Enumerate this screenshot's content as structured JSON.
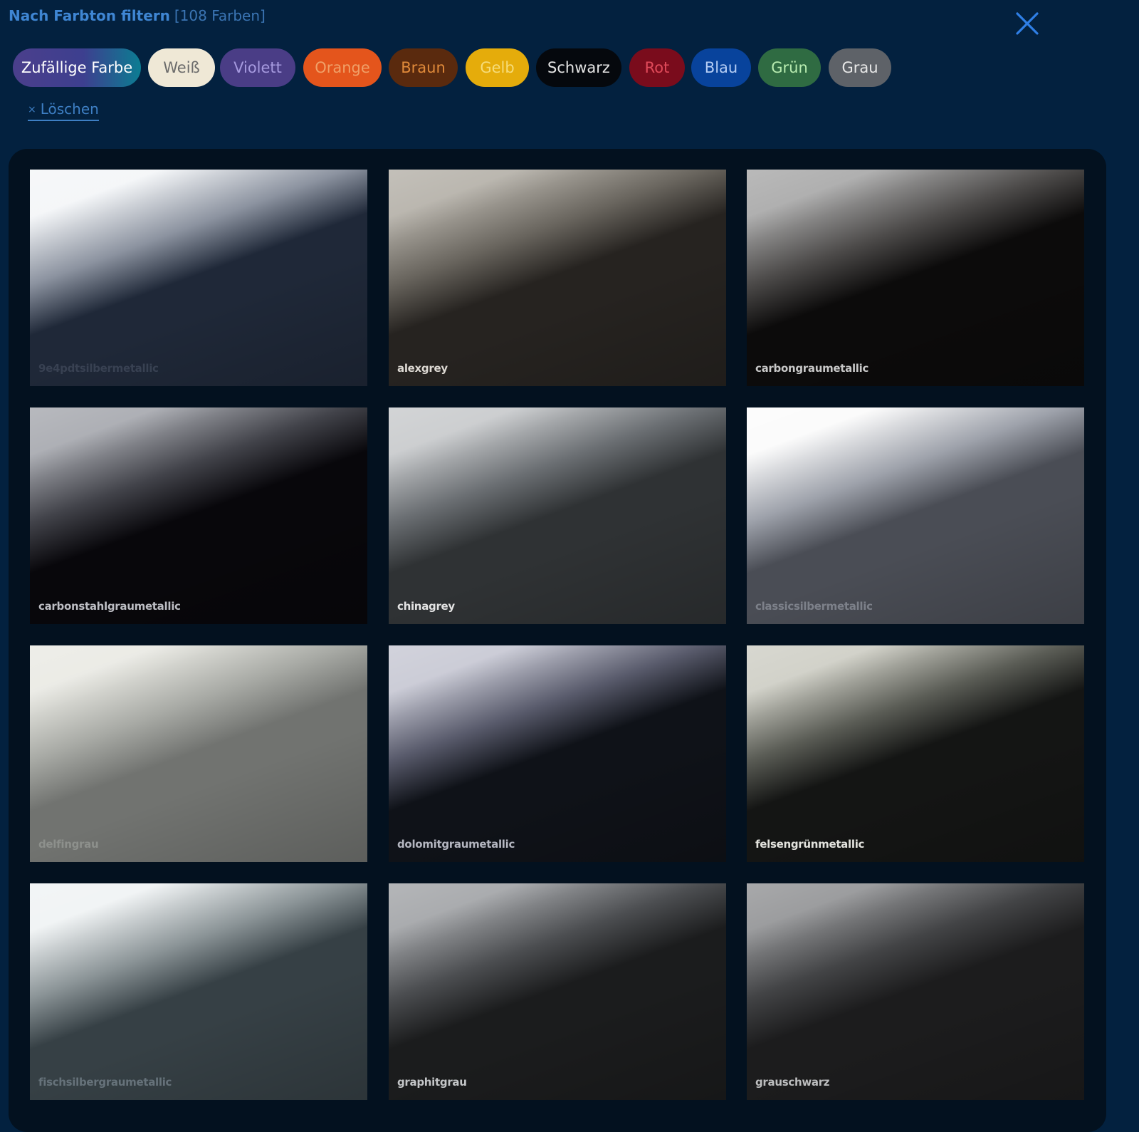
{
  "header": {
    "title": "Nach Farbton filtern",
    "count": "[108 Farben]"
  },
  "close_icon": "close-icon",
  "chips": [
    {
      "label": "Zufällige Farbe",
      "bg": "linear-gradient(90deg,#4b3f8c 0%,#3d3f8f 55%,#0c7d92 100%)",
      "fg": "#ffffff"
    },
    {
      "label": "Weiß",
      "bg": "#efe8d6",
      "fg": "#6b6b6b"
    },
    {
      "label": "Violett",
      "bg": "#4a3d86",
      "fg": "#a69adf"
    },
    {
      "label": "Orange",
      "bg": "#e4551c",
      "fg": "#f0a068"
    },
    {
      "label": "Braun",
      "bg": "#5a2a0e",
      "fg": "#e08a3a"
    },
    {
      "label": "Gelb",
      "bg": "#e5ac0b",
      "fg": "#f6dc7a"
    },
    {
      "label": "Schwarz",
      "bg": "#05080d",
      "fg": "#e6e6e6"
    },
    {
      "label": "Rot",
      "bg": "#7a0c1c",
      "fg": "#e04a5a"
    },
    {
      "label": "Blau",
      "bg": "#08439c",
      "fg": "#b6cef5"
    },
    {
      "label": "Grün",
      "bg": "#2f6b42",
      "fg": "#b8ecb0"
    },
    {
      "label": "Grau",
      "bg": "#5e6268",
      "fg": "#e8e8e8"
    }
  ],
  "clear": {
    "icon": "×",
    "label": "Löschen"
  },
  "swatches": [
    {
      "name": "9e4pdtsilbermetallic",
      "top": "#f4f6f8",
      "mid": "#8c93a0",
      "bottom": "#1f2838",
      "label_color": "#384152"
    },
    {
      "name": "alexgrey",
      "top": "#b6b2aa",
      "mid": "#69655e",
      "bottom": "#262320",
      "label_color": "#dedad4"
    },
    {
      "name": "carbongraumetallic",
      "top": "#aaaaaa",
      "mid": "#4d4b4a",
      "bottom": "#0c0b0b",
      "label_color": "#c8c8c8"
    },
    {
      "name": "carbonstahlgraumetallic",
      "top": "#a8aab0",
      "mid": "#42434a",
      "bottom": "#08070b",
      "label_color": "#bdbec4"
    },
    {
      "name": "chinagrey",
      "top": "#c9cbcd",
      "mid": "#6b6f73",
      "bottom": "#2f3234",
      "label_color": "#e4e4e4"
    },
    {
      "name": "classicsilbermetallic",
      "top": "#fbfbfb",
      "mid": "#9ea2ab",
      "bottom": "#4a4d55",
      "label_color": "#7d818a"
    },
    {
      "name": "delfingrau",
      "top": "#eaeae4",
      "mid": "#a8aaa5",
      "bottom": "#717370",
      "label_color": "#8d908c"
    },
    {
      "name": "dolomitgraumetallic",
      "top": "#c8c9d4",
      "mid": "#595b6c",
      "bottom": "#0f1218",
      "label_color": "#b4b6c0"
    },
    {
      "name": "felsengrünmetallic",
      "top": "#cfcfc6",
      "mid": "#5b5d56",
      "bottom": "#141514",
      "label_color": "#e3e3de"
    },
    {
      "name": "fischsilbergraumetallic",
      "top": "#f0f3f4",
      "mid": "#8b9497",
      "bottom": "#364045",
      "label_color": "#66727a"
    },
    {
      "name": "graphitgrau",
      "top": "#a4a6a9",
      "mid": "#4c4e51",
      "bottom": "#1b1c1d",
      "label_color": "#c4c6c8"
    },
    {
      "name": "grauschwarz",
      "top": "#959698",
      "mid": "#434446",
      "bottom": "#1c1c1d",
      "label_color": "#bdbebf"
    }
  ]
}
